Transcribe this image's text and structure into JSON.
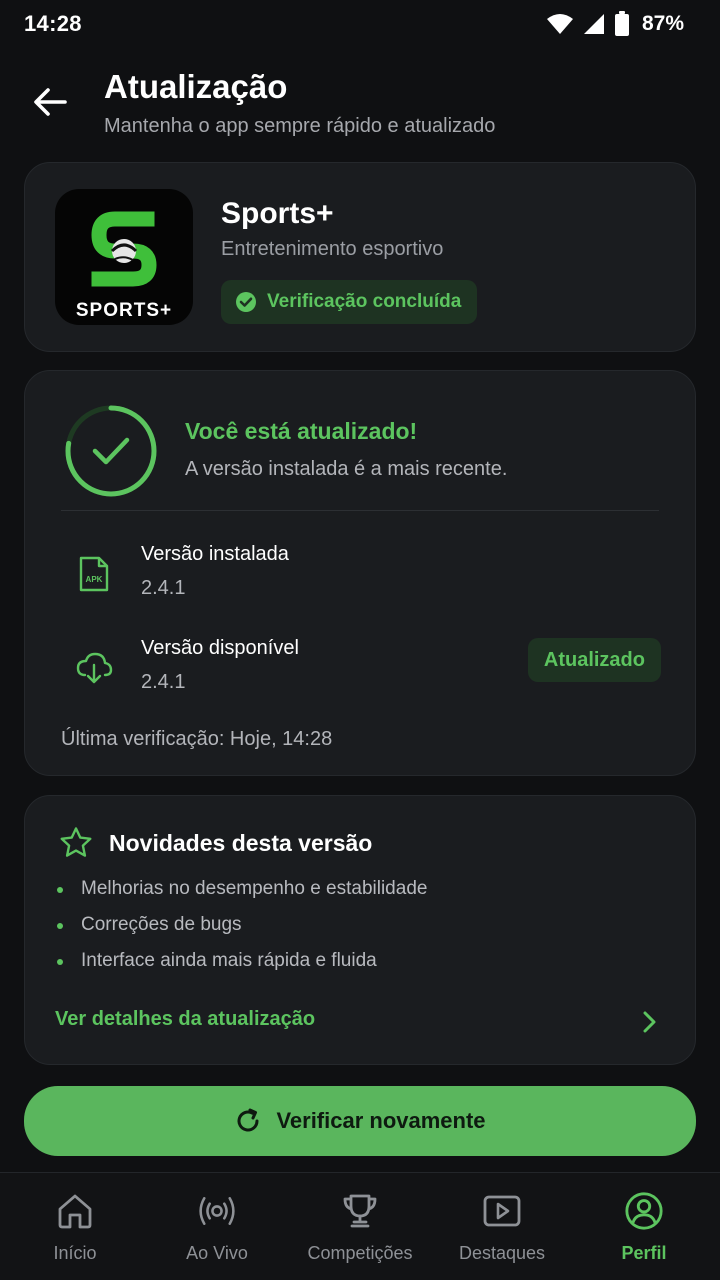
{
  "status_bar": {
    "time": "14:28",
    "battery": "87%"
  },
  "header": {
    "title": "Atualização",
    "subtitle": "Mantenha o app sempre rápido e atualizado"
  },
  "app": {
    "name": "Sports+",
    "category": "Entretenimento esportivo",
    "logo_text": "SPORTS+",
    "verified_label": "Verificação concluída"
  },
  "status": {
    "title": "Você está atualizado!",
    "description": "A versão instalada é a mais recente.",
    "installed_label": "Versão instalada",
    "installed_version": "2.4.1",
    "apk_icon_text": "APK",
    "available_label": "Versão disponível",
    "available_version": "2.4.1",
    "updated_badge": "Atualizado",
    "last_check": "Última verificação: Hoje, 14:28"
  },
  "news": {
    "title": "Novidades desta versão",
    "items": [
      "Melhorias no desempenho e estabilidade",
      "Correções de bugs",
      "Interface ainda mais rápida e fluida"
    ],
    "details_link": "Ver detalhes da atualização"
  },
  "actions": {
    "check_again": "Verificar novamente"
  },
  "bottom_nav": {
    "items": [
      {
        "label": "Início",
        "icon": "home-icon"
      },
      {
        "label": "Ao Vivo",
        "icon": "live-broadcast-icon"
      },
      {
        "label": "Competições",
        "icon": "trophy-icon"
      },
      {
        "label": "Destaques",
        "icon": "play-video-icon"
      },
      {
        "label": "Perfil",
        "icon": "profile-icon"
      }
    ],
    "active_index": 4
  },
  "colors": {
    "accent": "#5cc45f",
    "background": "#0f1012",
    "card": "#1a1c1f",
    "button": "#5ab65d"
  }
}
